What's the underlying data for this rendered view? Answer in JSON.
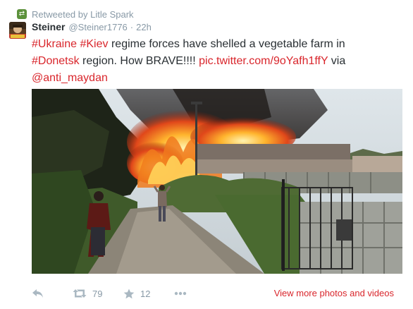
{
  "retweet_context": {
    "icon": "retweet-badge-icon",
    "text": "Retweeted by Litle Spark",
    "color": "#5c913b"
  },
  "author": {
    "avatar_label": "aaaa",
    "fullname": "Steiner",
    "username": "@Steiner1776",
    "separator": "·",
    "time": "22h"
  },
  "tweet": {
    "line1_tag1": "#Ukraine",
    "line1_tag2": "#Kiev",
    "line1_text": " regime forces have shelled a vegetable farm in",
    "line2_tag": "#Donetsk",
    "line2_text": " region. How BRAVE!!!! ",
    "line2_link": "pic.twitter.com/9oYafh1ffY",
    "line2_via": " via",
    "line3_mention": "@anti_maydan",
    "link_color": "#d9262c"
  },
  "media": {
    "alt_icon": "photo-burning-farm"
  },
  "actions": {
    "reply_icon": "reply-icon",
    "retweet_icon": "retweet-icon",
    "retweet_count": "79",
    "favorite_icon": "star-icon",
    "favorite_count": "12",
    "more_icon": "more-dots-icon",
    "view_more": "View more photos and videos"
  }
}
